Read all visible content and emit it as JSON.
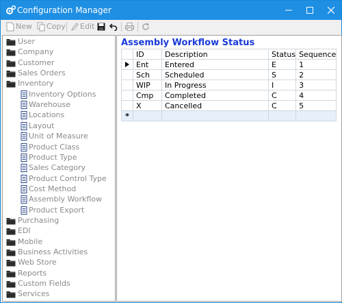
{
  "window": {
    "title": "Configuration Manager"
  },
  "toolbar": {
    "new_label": "New",
    "copy_label": "Copy",
    "edit_label": "Edit"
  },
  "tree": {
    "top_items": [
      {
        "label": "User"
      },
      {
        "label": "Company"
      },
      {
        "label": "Customer"
      },
      {
        "label": "Sales Orders"
      },
      {
        "label": "Inventory"
      }
    ],
    "inventory_children": [
      {
        "label": "Inventory Options"
      },
      {
        "label": "Warehouse"
      },
      {
        "label": "Locations"
      },
      {
        "label": "Layout"
      },
      {
        "label": "Unit of Measure"
      },
      {
        "label": "Product Class"
      },
      {
        "label": "Product Type"
      },
      {
        "label": "Sales Category"
      },
      {
        "label": "Product Control Type"
      },
      {
        "label": "Cost Method"
      },
      {
        "label": "Assembly Workflow"
      },
      {
        "label": "Product Export"
      }
    ],
    "bottom_items": [
      {
        "label": "Purchasing"
      },
      {
        "label": "EDI"
      },
      {
        "label": "Mobile"
      },
      {
        "label": "Business Activities"
      },
      {
        "label": "Web Store"
      },
      {
        "label": "Reports"
      },
      {
        "label": "Custom Fields"
      },
      {
        "label": "Services"
      }
    ]
  },
  "panel": {
    "title": "Assembly Workflow Status",
    "columns": [
      "ID",
      "Description",
      "Status",
      "Sequence"
    ],
    "rows": [
      {
        "id": "Ent",
        "description": "Entered",
        "status": "E",
        "sequence": "1"
      },
      {
        "id": "Sch",
        "description": "Scheduled",
        "status": "S",
        "sequence": "2"
      },
      {
        "id": "WIP",
        "description": "In Progress",
        "status": "I",
        "sequence": "3"
      },
      {
        "id": "Cmp",
        "description": "Completed",
        "status": "C",
        "sequence": "4"
      },
      {
        "id": "X",
        "description": "Cancelled",
        "status": "C",
        "sequence": "5"
      }
    ],
    "new_row_marker": "*"
  },
  "colors": {
    "titlebar": "#1e8fe3",
    "panel_title": "#1a3bd9",
    "new_row": "#e6f0fb"
  }
}
